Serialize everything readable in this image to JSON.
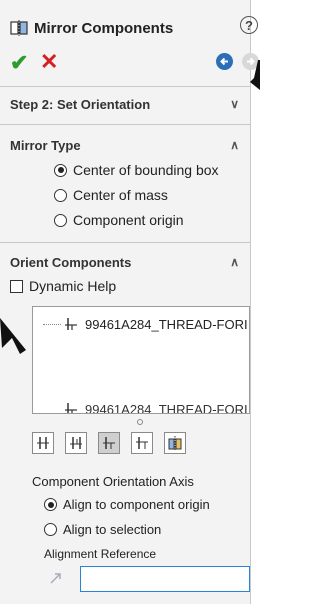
{
  "header": {
    "title": "Mirror Components",
    "help_glyph": "?"
  },
  "actions": {
    "ok_glyph": "✔",
    "cancel_glyph": "✕"
  },
  "step_section": {
    "title": "Step 2: Set Orientation",
    "chevron": "∨"
  },
  "mirror_type": {
    "title": "Mirror Type",
    "chevron": "∧",
    "options": [
      {
        "label": "Center of bounding box",
        "selected": true
      },
      {
        "label": "Center of mass",
        "selected": false
      },
      {
        "label": "Component origin",
        "selected": false
      }
    ]
  },
  "orient_components": {
    "title": "Orient Components",
    "chevron": "∧",
    "dynamic_help_label": "Dynamic Help",
    "items": [
      {
        "label": "99461A284_THREAD-FORI"
      },
      {
        "label": "99461A284_THREAD-FORI"
      }
    ],
    "tools": [
      "orient-1",
      "orient-2",
      "orient-3",
      "orient-4",
      "orient-5"
    ],
    "active_tool": 2
  },
  "axis": {
    "title": "Component Orientation Axis",
    "options": [
      {
        "label": "Align to component origin",
        "selected": true
      },
      {
        "label": "Align to selection",
        "selected": false
      }
    ]
  },
  "alignment_reference": {
    "label": "Alignment Reference",
    "value": ""
  },
  "colors": {
    "ok": "#2e9b2e",
    "cancel": "#d42020",
    "accent": "#2b82d9"
  }
}
